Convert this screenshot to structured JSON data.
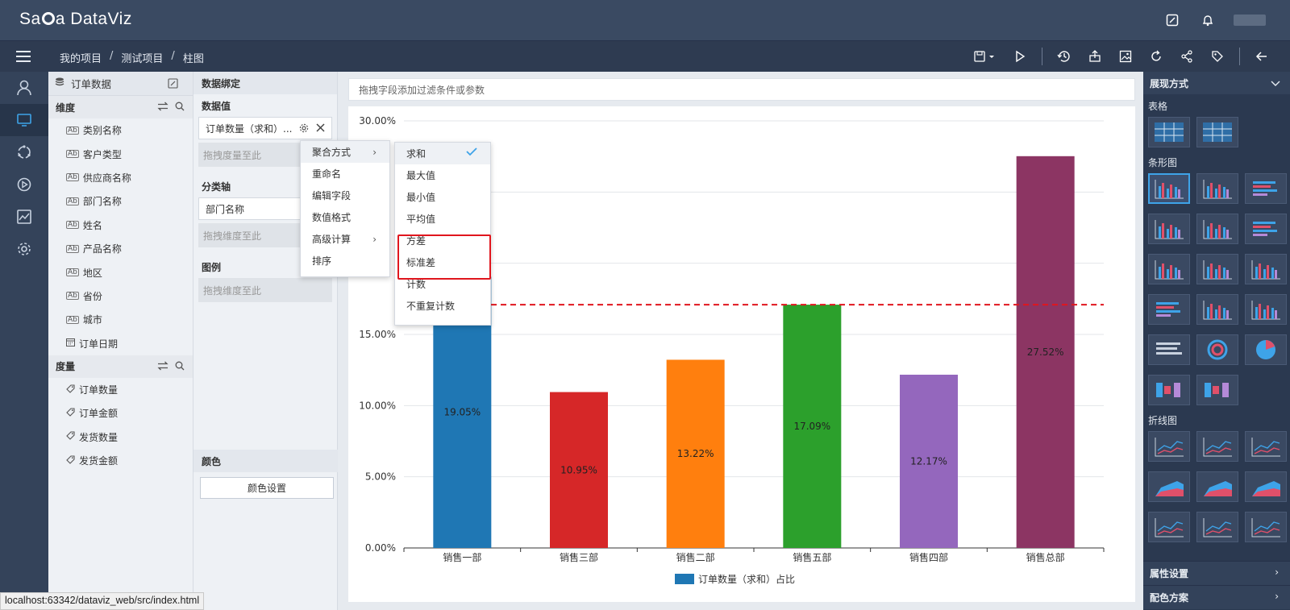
{
  "app": {
    "brand_part1": "Sa",
    "brand_part2": "a DataViz"
  },
  "breadcrumb": {
    "items": [
      "我的项目",
      "测试项目",
      "柱图"
    ]
  },
  "datasource": {
    "title": "订单数据"
  },
  "dimensions": {
    "label": "维度",
    "items": [
      "类别名称",
      "客户类型",
      "供应商名称",
      "部门名称",
      "姓名",
      "产品名称",
      "地区",
      "省份",
      "城市",
      "订单日期"
    ]
  },
  "measures": {
    "label": "度量",
    "items": [
      "订单数量",
      "订单金额",
      "发货数量",
      "发货金额"
    ]
  },
  "binding": {
    "title": "数据绑定",
    "values_label": "数据值",
    "value_pill": "订单数量（求和）...",
    "drop_measure": "拖拽度量至此",
    "axis_label": "分类轴",
    "axis_pill": "部门名称",
    "drop_dim": "拖拽维度至此",
    "legend_label": "图例",
    "legend_drop": "拖拽维度至此",
    "color_label": "颜色",
    "color_btn": "颜色设置"
  },
  "filterbar": {
    "placeholder": "拖拽字段添加过滤条件或参数"
  },
  "context_menu": {
    "items": [
      "聚合方式",
      "重命名",
      "编辑字段",
      "数值格式",
      "高级计算",
      "排序"
    ]
  },
  "agg_submenu": {
    "items": [
      "求和",
      "最大值",
      "最小值",
      "平均值",
      "方差",
      "标准差",
      "计数",
      "不重复计数"
    ],
    "selected": "求和"
  },
  "right_panel": {
    "title": "展现方式",
    "sections": [
      "表格",
      "条形图",
      "折线图"
    ],
    "footer": [
      "属性设置",
      "配色方案"
    ]
  },
  "status_url": "localhost:63342/dataviz_web/src/index.html",
  "chart_data": {
    "type": "bar",
    "categories": [
      "销售一部",
      "销售三部",
      "销售二部",
      "销售五部",
      "销售四部",
      "销售总部"
    ],
    "values": [
      19.05,
      10.95,
      13.22,
      17.09,
      12.17,
      27.52
    ],
    "data_labels": [
      "19.05%",
      "10.95%",
      "13.22%",
      "17.09%",
      "12.17%",
      "27.52%"
    ],
    "colors": [
      "#1f77b4",
      "#d62728",
      "#ff7f0e",
      "#2ca02c",
      "#9467bd",
      "#8c3563"
    ],
    "y_ticks": [
      "0.00%",
      "5.00%",
      "10.00%",
      "15.00%",
      "30.00%"
    ],
    "y_tick_values": [
      0,
      5,
      10,
      15,
      30
    ],
    "ylim": [
      0,
      30
    ],
    "reference_line": 17.09,
    "legend": "订单数量（求和）占比",
    "legend_color": "#1f77b4",
    "grid": true,
    "legend_position": "bottom"
  }
}
